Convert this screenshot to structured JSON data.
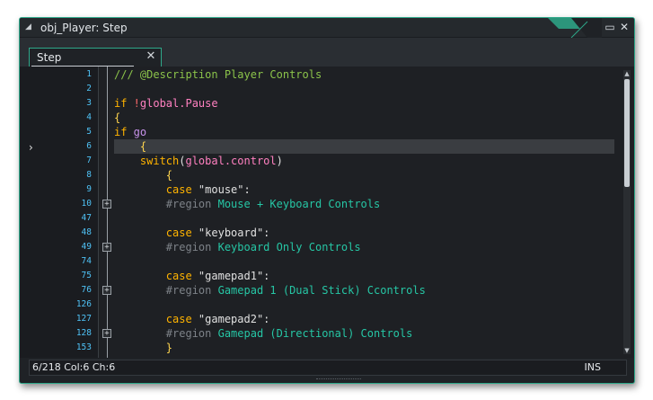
{
  "window": {
    "title": "obj_Player: Step",
    "accent_color": "#2ea88a",
    "icons": {
      "collapse": "triangle-down-left-icon",
      "maximize": "maximize-icon",
      "close": "close-icon"
    }
  },
  "tab": {
    "label": "Step",
    "close_icon": "close-icon"
  },
  "editor": {
    "current_line_index": 5,
    "lines": [
      {
        "no": "1",
        "fold": false
      },
      {
        "no": "2",
        "fold": false
      },
      {
        "no": "3",
        "fold": false
      },
      {
        "no": "4",
        "fold": false
      },
      {
        "no": "5",
        "fold": false
      },
      {
        "no": "6",
        "fold": false
      },
      {
        "no": "7",
        "fold": false
      },
      {
        "no": "8",
        "fold": false
      },
      {
        "no": "9",
        "fold": false
      },
      {
        "no": "10",
        "fold": true
      },
      {
        "no": "47",
        "fold": false
      },
      {
        "no": "48",
        "fold": false
      },
      {
        "no": "49",
        "fold": true
      },
      {
        "no": "74",
        "fold": false
      },
      {
        "no": "75",
        "fold": false
      },
      {
        "no": "76",
        "fold": true
      },
      {
        "no": "126",
        "fold": false
      },
      {
        "no": "127",
        "fold": false
      },
      {
        "no": "128",
        "fold": true
      },
      {
        "no": "153",
        "fold": false
      }
    ],
    "code": {
      "l1_comment": "/// @Description Player Controls",
      "l3_if": "if",
      "l3_not": " !",
      "l3_global": "global.Pause",
      "l4_brace": "{",
      "l5_if": "if",
      "l5_var": " go",
      "l6_brace": "    {",
      "l7_switch": "    switch",
      "l7_open": "(",
      "l7_global": "global.control",
      "l7_close": ")",
      "l8_brace": "        {",
      "l9_case": "        case",
      "l9_str": " \"mouse\":",
      "l10_region": "        #region",
      "l10_text": " Mouse + Keyboard Controls",
      "l48_case": "        case",
      "l48_str": " \"keyboard\":",
      "l49_region": "        #region",
      "l49_text": " Keyboard Only Controls",
      "l75_case": "        case",
      "l75_str": " \"gamepad1\":",
      "l76_region": "        #region",
      "l76_text": " Gamepad 1 (Dual Stick) Ccontrols",
      "l127_case": "        case",
      "l127_str": " \"gamepad2\":",
      "l128_region": "        #region",
      "l128_text": " Gamepad (Directional) Controls",
      "l153_brace": "        }"
    }
  },
  "status": {
    "position": "6/218 Col:6 Ch:6",
    "mode": "INS"
  }
}
